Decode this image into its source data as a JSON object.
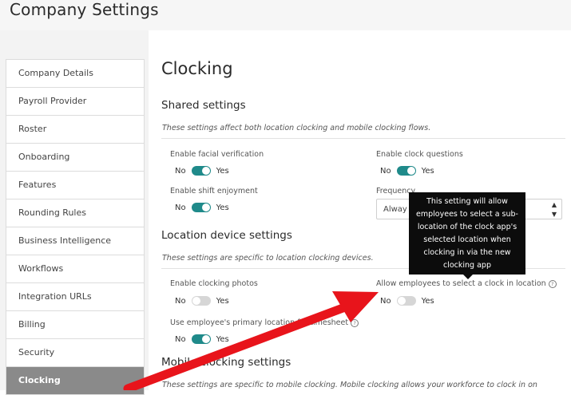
{
  "header": {
    "title": "Company Settings"
  },
  "sidebar": {
    "items": [
      {
        "label": "Company Details"
      },
      {
        "label": "Payroll Provider"
      },
      {
        "label": "Roster"
      },
      {
        "label": "Onboarding"
      },
      {
        "label": "Features"
      },
      {
        "label": "Rounding Rules"
      },
      {
        "label": "Business Intelligence"
      },
      {
        "label": "Workflows"
      },
      {
        "label": "Integration URLs"
      },
      {
        "label": "Billing"
      },
      {
        "label": "Security"
      },
      {
        "label": "Clocking"
      }
    ],
    "active_index": 11
  },
  "main": {
    "title": "Clocking",
    "shared": {
      "heading": "Shared settings",
      "description": "These settings affect both location clocking and mobile clocking flows.",
      "facial_verification": {
        "label": "Enable facial verification",
        "no": "No",
        "yes": "Yes",
        "enabled": true
      },
      "clock_questions": {
        "label": "Enable clock questions",
        "no": "No",
        "yes": "Yes",
        "enabled": true
      },
      "shift_enjoyment": {
        "label": "Enable shift enjoyment",
        "no": "No",
        "yes": "Yes",
        "enabled": true
      },
      "frequency": {
        "label": "Frequency",
        "value": "Alway"
      }
    },
    "location": {
      "heading": "Location device settings",
      "description": "These settings are specific to location clocking devices.",
      "clocking_photos": {
        "label": "Enable clocking photos",
        "no": "No",
        "yes": "Yes",
        "enabled": false
      },
      "sub_location": {
        "label": "Allow employees to select a clock in location",
        "no": "No",
        "yes": "Yes",
        "enabled": false
      },
      "primary_location": {
        "label": "Use employee's primary location for timesheet",
        "no": "No",
        "yes": "Yes",
        "enabled": true
      }
    },
    "mobile": {
      "heading": "Mobile clocking settings",
      "description": "These settings are specific to mobile clocking. Mobile clocking allows your workforce to clock in on"
    },
    "tooltip": {
      "text": "This setting will allow employees to select a sub-location of the clock app's selected location when clocking in via the new clocking app"
    }
  },
  "colors": {
    "toggle_on": "#1f8a8a",
    "toggle_off": "#d6d6d6",
    "active_sidebar": "#8a8a8a",
    "arrow": "#e8141b",
    "tooltip_bg": "#0c0c0c"
  }
}
